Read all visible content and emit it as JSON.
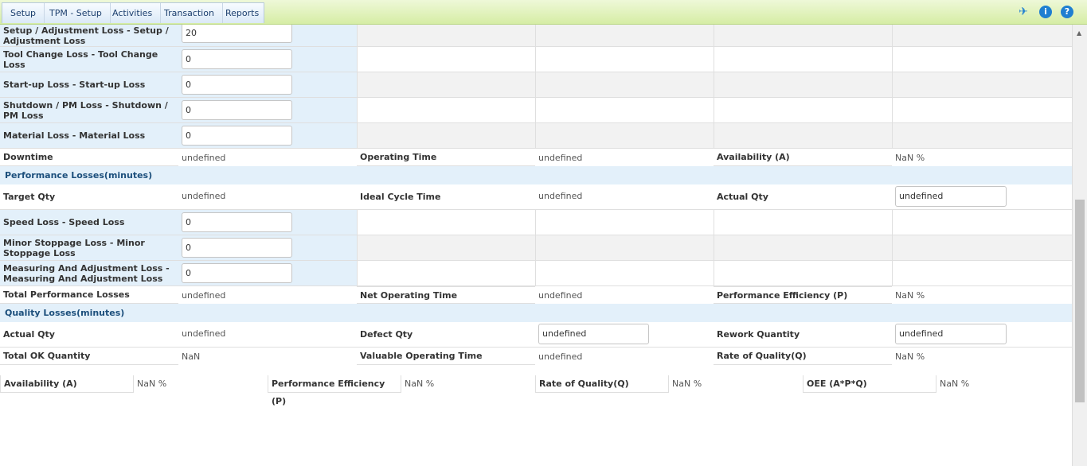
{
  "menu": {
    "items": [
      "Setup",
      "TPM - Setup",
      "Activities",
      "Transaction",
      "Reports"
    ]
  },
  "toolbar": {
    "pin_glyph": "✈",
    "info_glyph": "i",
    "help_glyph": "?"
  },
  "colors": {
    "menubar": "#d6eda5",
    "label_bg": "#e3f0fa",
    "section_text": "#1c4f7c",
    "info": "#1f7fd1",
    "help": "#1f7fd1"
  },
  "availability_losses": [
    {
      "label": "Setup / Adjustment Loss - Setup / Adjustment Loss",
      "value": "20"
    },
    {
      "label": "Tool Change Loss - Tool Change Loss",
      "value": "0"
    },
    {
      "label": "Start-up Loss - Start-up Loss",
      "value": "0"
    },
    {
      "label": "Shutdown / PM Loss - Shutdown / PM Loss",
      "value": "0"
    },
    {
      "label": "Material Loss - Material Loss",
      "value": "0"
    }
  ],
  "downtime_row": {
    "downtime_label": "Downtime",
    "downtime_value": "undefined",
    "operating_time_label": "Operating Time",
    "operating_time_value": "undefined",
    "availability_label": "Availability (A)",
    "availability_value": "NaN %"
  },
  "performance": {
    "section_title": "Performance Losses(minutes)",
    "target_qty_label": "Target Qty",
    "target_qty_value": "undefined",
    "ideal_cycle_label": "Ideal Cycle Time",
    "ideal_cycle_value": "undefined",
    "actual_qty_label": "Actual Qty",
    "actual_qty_value": "undefined",
    "losses": [
      {
        "label": "Speed Loss - Speed Loss",
        "value": "0"
      },
      {
        "label": "Minor Stoppage Loss - Minor Stoppage Loss",
        "value": "0"
      },
      {
        "label": "Measuring And Adjustment Loss - Measuring And Adjustment Loss",
        "value": "0"
      }
    ],
    "total_label": "Total Performance Losses",
    "total_value": "undefined",
    "net_operating_label": "Net Operating Time",
    "net_operating_value": "undefined",
    "efficiency_label": "Performance Efficiency (P)",
    "efficiency_value": "NaN %"
  },
  "quality": {
    "section_title": "Quality Losses(minutes)",
    "actual_qty_label": "Actual Qty",
    "actual_qty_value": "undefined",
    "defect_qty_label": "Defect Qty",
    "defect_qty_value": "undefined",
    "rework_label": "Rework Quantity",
    "rework_value": "undefined",
    "total_ok_label": "Total OK Quantity",
    "total_ok_value": "NaN",
    "valuable_label": "Valuable Operating Time",
    "valuable_value": "undefined",
    "rate_label": "Rate of Quality(Q)",
    "rate_value": "NaN %"
  },
  "summary": [
    {
      "label": "Availability (A)",
      "value": "NaN %"
    },
    {
      "label": "Performance Efficiency (P)",
      "value": "NaN %"
    },
    {
      "label": "Rate of Quality(Q)",
      "value": "NaN %"
    },
    {
      "label": "OEE (A*P*Q)",
      "value": "NaN %"
    }
  ]
}
